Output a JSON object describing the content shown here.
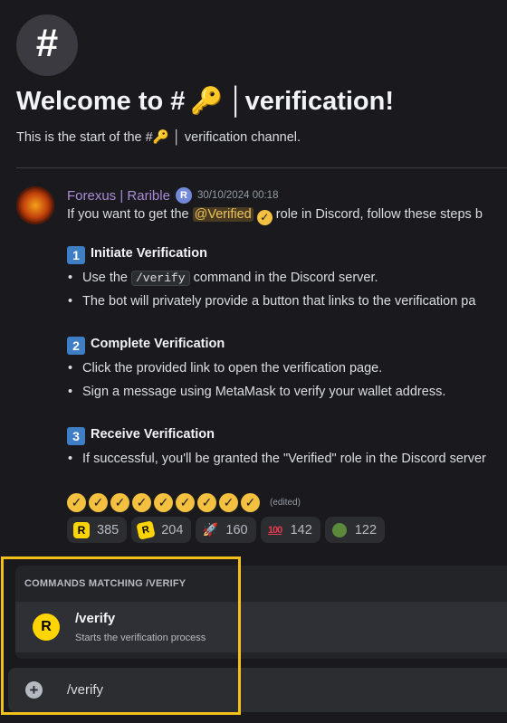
{
  "channel": {
    "hash_symbol": "#",
    "welcome_prefix": "Welcome to #",
    "channel_emoji": "🔑",
    "welcome_suffix": "│verification!",
    "start_prefix": "This is the start of the #",
    "start_suffix": " │ verification channel."
  },
  "message": {
    "author": "Forexus | Rarible",
    "app_badge": "R",
    "timestamp": "30/10/2024 00:18",
    "intro_before": "If you want to get the ",
    "intro_mention": "@Verified",
    "intro_after": " role in Discord, follow these steps b",
    "steps": [
      {
        "number": "1",
        "title": "Initiate Verification",
        "bullets": [
          {
            "before": "Use the ",
            "code": "/verify",
            "after": " command in the Discord server."
          },
          {
            "before": "The bot will privately provide a button that links to the verification pa",
            "code": "",
            "after": ""
          }
        ]
      },
      {
        "number": "2",
        "title": "Complete Verification",
        "bullets": [
          {
            "before": "Click the provided link to open the verification page.",
            "code": "",
            "after": ""
          },
          {
            "before": "Sign a message using MetaMask to verify your wallet address.",
            "code": "",
            "after": ""
          }
        ]
      },
      {
        "number": "3",
        "title": "Receive Verification",
        "bullets": [
          {
            "before": "If successful, you'll be granted the \"Verified\" role in the Discord server",
            "code": "",
            "after": ""
          }
        ]
      }
    ],
    "edited_label": "(edited)",
    "verified_badge_count": 9,
    "reactions": [
      {
        "icon": "rarible-logo-icon",
        "count": "385"
      },
      {
        "icon": "rarible-tilted-logo-icon",
        "count": "204"
      },
      {
        "icon": "rocket-icon",
        "count": "160"
      },
      {
        "icon": "hundred-points-icon",
        "count": "142"
      },
      {
        "icon": "pepe-icon",
        "count": "122"
      }
    ]
  },
  "autocomplete": {
    "header": "COMMANDS MATCHING /VERIFY",
    "item_name": "/verify",
    "item_description": "Starts the verification process",
    "item_icon": "R"
  },
  "input": {
    "plus": "+",
    "value": "/verify"
  },
  "colors": {
    "accent": "#f2c21a",
    "author": "#a98bd6",
    "rarible_yellow": "#fed501"
  }
}
